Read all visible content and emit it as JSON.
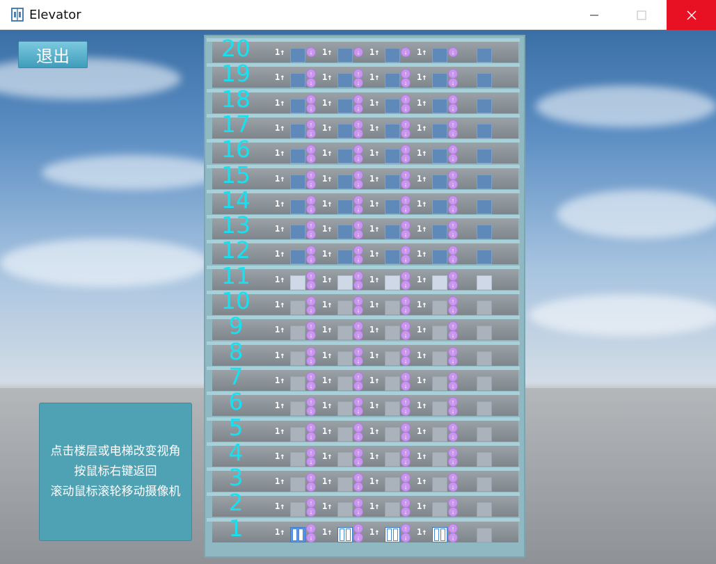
{
  "window": {
    "title": "Elevator",
    "icon": "elevator-app-icon",
    "minimize_icon": "minimize-icon",
    "maximize_icon": "maximize-icon",
    "close_icon": "close-icon",
    "close_color": "#e81123"
  },
  "exit_button": {
    "label": "退出"
  },
  "info_panel": {
    "lines": [
      "点击楼层或电梯改变视角",
      "按鼠标右键返回",
      "滚动鼠标滚轮移动摄像机"
    ]
  },
  "building": {
    "floors": [
      "20",
      "19",
      "18",
      "17",
      "16",
      "15",
      "14",
      "13",
      "12",
      "11",
      "10",
      "9",
      "8",
      "7",
      "6",
      "5",
      "4",
      "3",
      "2",
      "1"
    ],
    "elevator_indicators": [
      "1↑",
      "1↑",
      "1↑",
      "1↑"
    ],
    "floor_number_color": "#19e0f0",
    "call_button_color": "#c996ee",
    "elevator_count": 4,
    "current_floor": "1"
  }
}
